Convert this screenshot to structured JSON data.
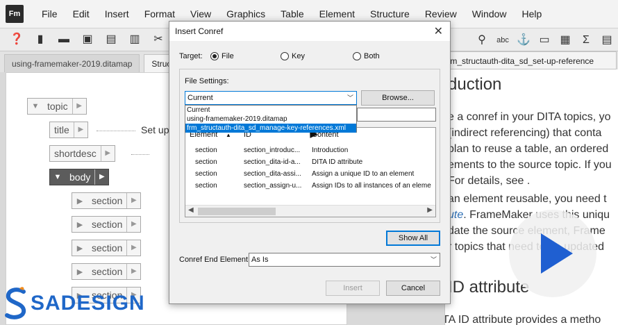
{
  "app": {
    "logo_text": "Fm"
  },
  "menu": [
    "File",
    "Edit",
    "Insert",
    "Format",
    "View",
    "Graphics",
    "Table",
    "Element",
    "Structure",
    "Review",
    "Window",
    "Help"
  ],
  "toolbar": {
    "left_icons": [
      "help-icon",
      "new-document-icon",
      "open-folder-icon",
      "save-icon",
      "save-as-icon",
      "print-icon",
      "cut-icon",
      "copy-icon"
    ],
    "right_icons": [
      "zoom-icon",
      "spell-check-icon",
      "anchor-icon",
      "text-frame-icon",
      "table-icon",
      "equation-icon",
      "layout-icon"
    ]
  },
  "tabs": [
    {
      "label": "using-framemaker-2019.ditamap",
      "active": false
    },
    {
      "label": "Struct",
      "active": true
    }
  ],
  "doc_tab": {
    "label": "frm_structauth-dita_sd_set-up-reference"
  },
  "structure": {
    "nodes": [
      "topic",
      "title",
      "shortdesc",
      "body",
      "section",
      "section",
      "section",
      "section",
      "section"
    ],
    "title_text": "Set up"
  },
  "document": {
    "heading1": "duction",
    "lines": [
      "e a conref in your DITA topics, yo",
      "(indirect referencing) that conta",
      "plan to reuse a table, an ordered",
      "ements to the source topic. If you",
      "For details, see .",
      "an element reusable, you need t",
      "ute. FrameMaker uses this uniqu",
      "date the source element, Frame",
      "r topics that need to be updated"
    ],
    "link_word": "ute",
    "heading2": "ID attribute",
    "bottom_line": "The DITA ID attribute provides a metho"
  },
  "dialog": {
    "title": "Insert Conref",
    "target_label": "Target:",
    "radios": [
      {
        "label": "File",
        "selected": true
      },
      {
        "label": "Key",
        "selected": false
      },
      {
        "label": "Both",
        "selected": false
      }
    ],
    "file_settings_label": "File Settings:",
    "file_combo_value": "Current",
    "browse_label": "Browse...",
    "dropdown_options": [
      {
        "label": "Current",
        "selected": false
      },
      {
        "label": "using-framemaker-2019.ditamap",
        "selected": false
      },
      {
        "label": "frm_structauth-dita_sd_manage-key-references.xml",
        "selected": true
      }
    ],
    "table": {
      "headers": [
        "Element",
        "ID",
        "Content"
      ],
      "rows": [
        [
          "section",
          "section_introduc...",
          "Introduction"
        ],
        [
          "section",
          "section_dita-id-a...",
          "DITA ID attribute"
        ],
        [
          "section",
          "section_dita-assi...",
          "Assign a unique ID to an element"
        ],
        [
          "section",
          "section_assign-u...",
          "Assign IDs to all instances of an eleme"
        ]
      ]
    },
    "show_all_label": "Show All",
    "end_element_label": "Conref End Element:",
    "end_element_value": "As Is",
    "insert_label": "Insert",
    "cancel_label": "Cancel"
  },
  "brand": {
    "name": "SADESIGN"
  },
  "colors": {
    "accent": "#0078d7",
    "brand": "#1f67c8",
    "play": "#1f5fd1"
  }
}
